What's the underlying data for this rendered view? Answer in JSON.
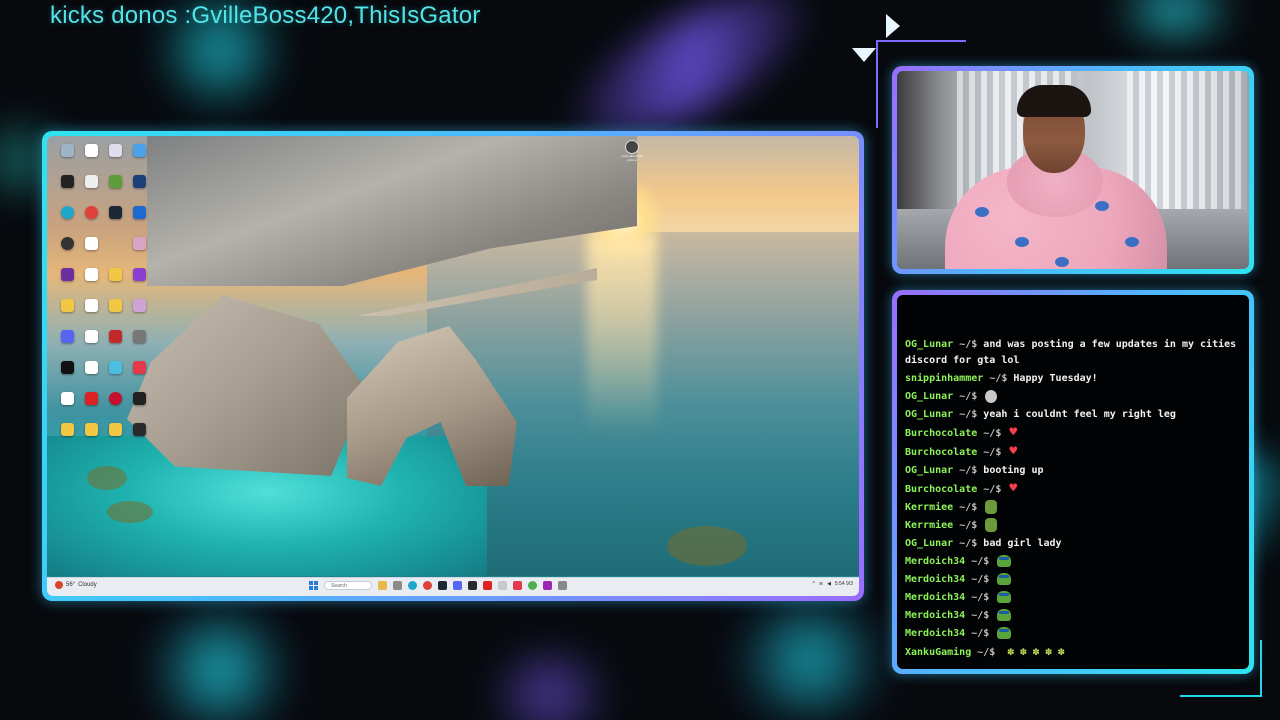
{
  "overlay": {
    "ticker_text": "kicks donos :GvilleBoss420,ThisIsGator"
  },
  "desktop": {
    "taskbar": {
      "weather_temp": "56°",
      "weather_desc": "Cloudy",
      "search_placeholder": "Search",
      "clock_time": "5:54",
      "clock_date": "9/3"
    },
    "top_icon_label": "Learn about this picture"
  },
  "chat": {
    "partial_top": {
      "user": "OG_Lunar",
      "prompt": "~/$",
      "text": "and was posting a few updates in my cities discord for gta lol"
    },
    "messages": [
      {
        "user": "snippinhammer",
        "prompt": "~/$",
        "text": "Happy Tuesday!",
        "emote": ""
      },
      {
        "user": "OG_Lunar",
        "prompt": "~/$",
        "text": "",
        "emote": "face-emote"
      },
      {
        "user": "OG_Lunar",
        "prompt": "~/$",
        "text": "yeah i couldnt feel my right leg",
        "emote": ""
      },
      {
        "user": "Burchocolate",
        "prompt": "~/$",
        "text": "",
        "emote": "heart-emote"
      },
      {
        "user": "Burchocolate",
        "prompt": "~/$",
        "text": "",
        "emote": "heart-emote"
      },
      {
        "user": "OG_Lunar",
        "prompt": "~/$",
        "text": "booting up",
        "emote": ""
      },
      {
        "user": "Burchocolate",
        "prompt": "~/$",
        "text": "",
        "emote": "heart-emote"
      },
      {
        "user": "Kerrmiee",
        "prompt": "~/$",
        "text": "",
        "emote": "frog-emote"
      },
      {
        "user": "Kerrmiee",
        "prompt": "~/$",
        "text": "",
        "emote": "frog-emote"
      },
      {
        "user": "OG_Lunar",
        "prompt": "~/$",
        "text": "bad girl lady",
        "emote": ""
      },
      {
        "user": "Merdoich34",
        "prompt": "~/$",
        "text": "",
        "emote": "pepe-emote"
      },
      {
        "user": "Merdoich34",
        "prompt": "~/$",
        "text": "",
        "emote": "pepe-emote"
      },
      {
        "user": "Merdoich34",
        "prompt": "~/$",
        "text": "",
        "emote": "pepe-emote"
      },
      {
        "user": "Merdoich34",
        "prompt": "~/$",
        "text": "",
        "emote": "pepe-emote"
      },
      {
        "user": "Merdoich34",
        "prompt": "~/$",
        "text": "",
        "emote": "pepe-emote"
      },
      {
        "user": "XankuGaming",
        "prompt": "~/$",
        "text": "",
        "emote": "leaf-emote-row"
      }
    ]
  },
  "colors": {
    "ticker": "#54e3e8",
    "chat_user": "#8ef25a",
    "frame_gradient_start": "#2ee4ef",
    "frame_gradient_end": "#9a6cff"
  }
}
